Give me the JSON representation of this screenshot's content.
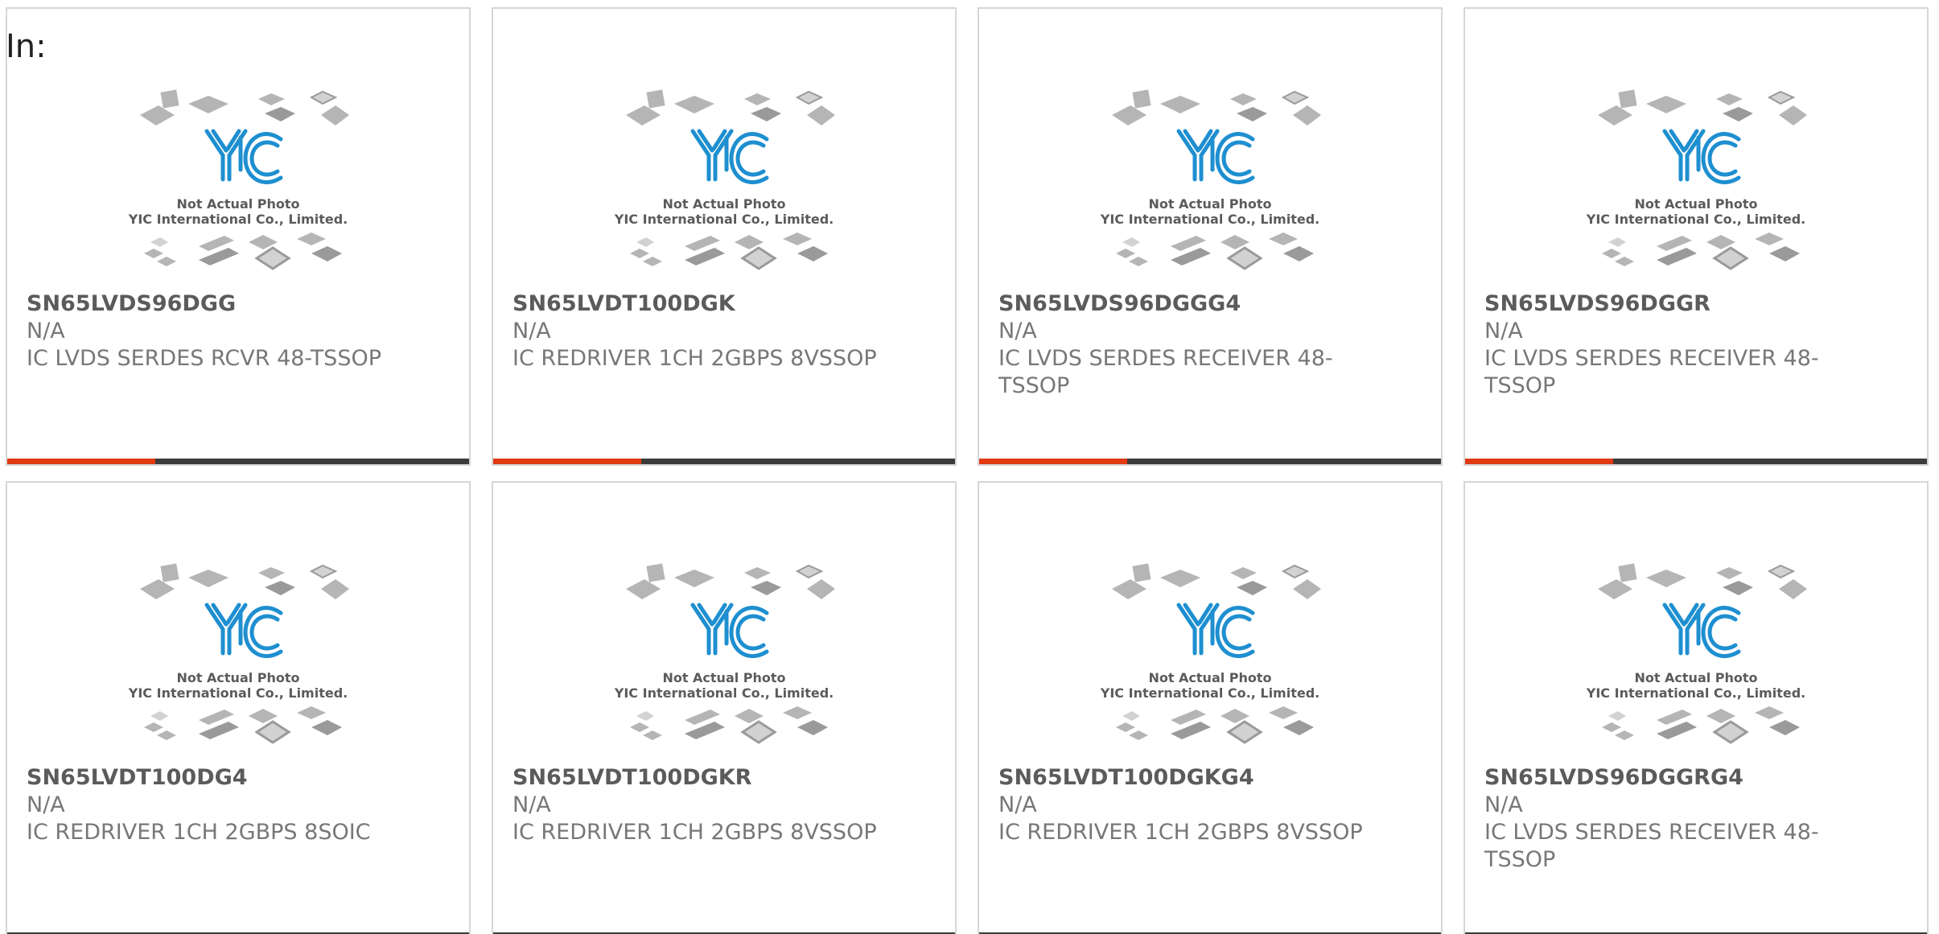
{
  "header": {
    "label": "In:"
  },
  "colors": {
    "accent": "#e03a12",
    "bar": "#3c3c3c",
    "logo": "#1e8fd0",
    "chip": "#b5b5b5"
  },
  "placeholder_image": {
    "line1": "Not Actual Photo",
    "line2": "YIC International Co., Limited.",
    "logo_text": "YIC"
  },
  "products": [
    {
      "part_number": "SN65LVDS96DGG",
      "manufacturer": "N/A",
      "description": "IC LVDS SERDES RCVR 48-TSSOP",
      "progress": 0.32
    },
    {
      "part_number": "SN65LVDT100DGK",
      "manufacturer": "N/A",
      "description": "IC REDRIVER 1CH 2GBPS 8VSSOP",
      "progress": 0.32
    },
    {
      "part_number": "SN65LVDS96DGGG4",
      "manufacturer": "N/A",
      "description": "IC LVDS SERDES RECEIVER 48-TSSOP",
      "progress": 0.32
    },
    {
      "part_number": "SN65LVDS96DGGR",
      "manufacturer": "N/A",
      "description": "IC LVDS SERDES RECEIVER 48-TSSOP",
      "progress": 0.32
    },
    {
      "part_number": "SN65LVDT100DG4",
      "manufacturer": "N/A",
      "description": "IC REDRIVER 1CH 2GBPS 8SOIC",
      "progress": 0
    },
    {
      "part_number": "SN65LVDT100DGKR",
      "manufacturer": "N/A",
      "description": "IC REDRIVER 1CH 2GBPS 8VSSOP",
      "progress": 0
    },
    {
      "part_number": "SN65LVDT100DGKG4",
      "manufacturer": "N/A",
      "description": "IC REDRIVER 1CH 2GBPS 8VSSOP",
      "progress": 0
    },
    {
      "part_number": "SN65LVDS96DGGRG4",
      "manufacturer": "N/A",
      "description": "IC LVDS SERDES RECEIVER 48-TSSOP",
      "progress": 0
    }
  ]
}
